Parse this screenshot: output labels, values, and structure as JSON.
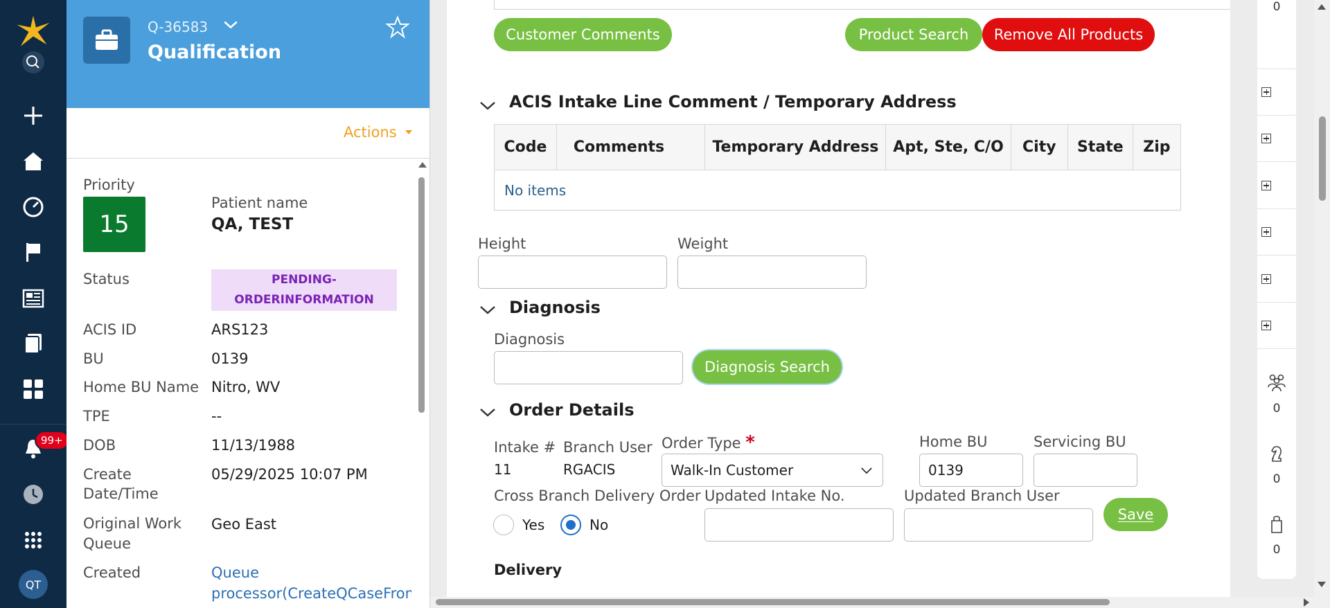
{
  "header": {
    "case_id": "Q-36583",
    "case_title": "Qualification",
    "actions_label": "Actions"
  },
  "nav": {
    "notifications_badge": "99+",
    "avatar_initials": "QT"
  },
  "summary": {
    "priority_label": "Priority",
    "priority_value": "15",
    "patient_name_label": "Patient name",
    "patient_name_value": "QA, TEST",
    "status_label": "Status",
    "status_line1": "PENDING-",
    "status_line2": "ORDERINFORMATION",
    "acis_id_label": "ACIS ID",
    "acis_id_value": "ARS123",
    "bu_label": "BU",
    "bu_value": "0139",
    "home_bu_name_label": "Home BU Name",
    "home_bu_name_value": "Nitro, WV",
    "tpe_label": "TPE",
    "tpe_value": "--",
    "dob_label": "DOB",
    "dob_value": "11/13/1988",
    "create_dt_label_1": "Create",
    "create_dt_label_2": "Date/Time",
    "create_dt_value": "05/29/2025 10:07 PM",
    "owq_label_1": "Original Work",
    "owq_label_2": "Queue",
    "owq_value": "Geo East",
    "created_label": "Created",
    "created_value_1": "Queue",
    "created_value_2": "processor(CreateQCaseFromI"
  },
  "buttons": {
    "customer_comments": "Customer Comments",
    "product_search": "Product Search",
    "remove_all_products": "Remove All Products",
    "diagnosis_search": "Diagnosis Search",
    "save": "Save"
  },
  "acis_section": {
    "title": "ACIS Intake Line Comment / Temporary Address",
    "columns": [
      "Code",
      "Comments",
      "Temporary Address",
      "Apt, Ste, C/O",
      "City",
      "State",
      "Zip"
    ],
    "empty_text": "No items"
  },
  "vitals": {
    "height_label": "Height",
    "height_value": "",
    "weight_label": "Weight",
    "weight_value": ""
  },
  "diagnosis": {
    "section_title": "Diagnosis",
    "field_label": "Diagnosis",
    "field_value": ""
  },
  "order_details": {
    "section_title": "Order Details",
    "intake_label": "Intake #",
    "intake_value": "11",
    "branch_user_label": "Branch User",
    "branch_user_value": "RGACIS",
    "order_type_label": "Order Type",
    "order_type_required": "*",
    "order_type_value": "Walk-In Customer",
    "home_bu_label": "Home BU",
    "home_bu_value": "0139",
    "servicing_bu_label": "Servicing BU",
    "servicing_bu_value": "",
    "cross_branch_label": "Cross Branch Delivery Order",
    "radio_yes": "Yes",
    "radio_no": "No",
    "selected": "No",
    "updated_intake_label": "Updated Intake No.",
    "updated_intake_value": "",
    "updated_branch_label": "Updated Branch User",
    "updated_branch_value": ""
  },
  "delivery": {
    "section_title": "Delivery"
  },
  "rail": {
    "top_count": "0",
    "group_count": "0",
    "chess_count": "0",
    "bag_count": "0"
  },
  "colors": {
    "nav_bg": "#0f2a45",
    "header_bg": "#4a9fdc",
    "green_button": "#78c043",
    "red_button": "#e00e0e",
    "priority_bg": "#0a7a2e",
    "status_bg": "#eedcf8",
    "status_text": "#7a22b5",
    "actions_color": "#f0a020"
  }
}
